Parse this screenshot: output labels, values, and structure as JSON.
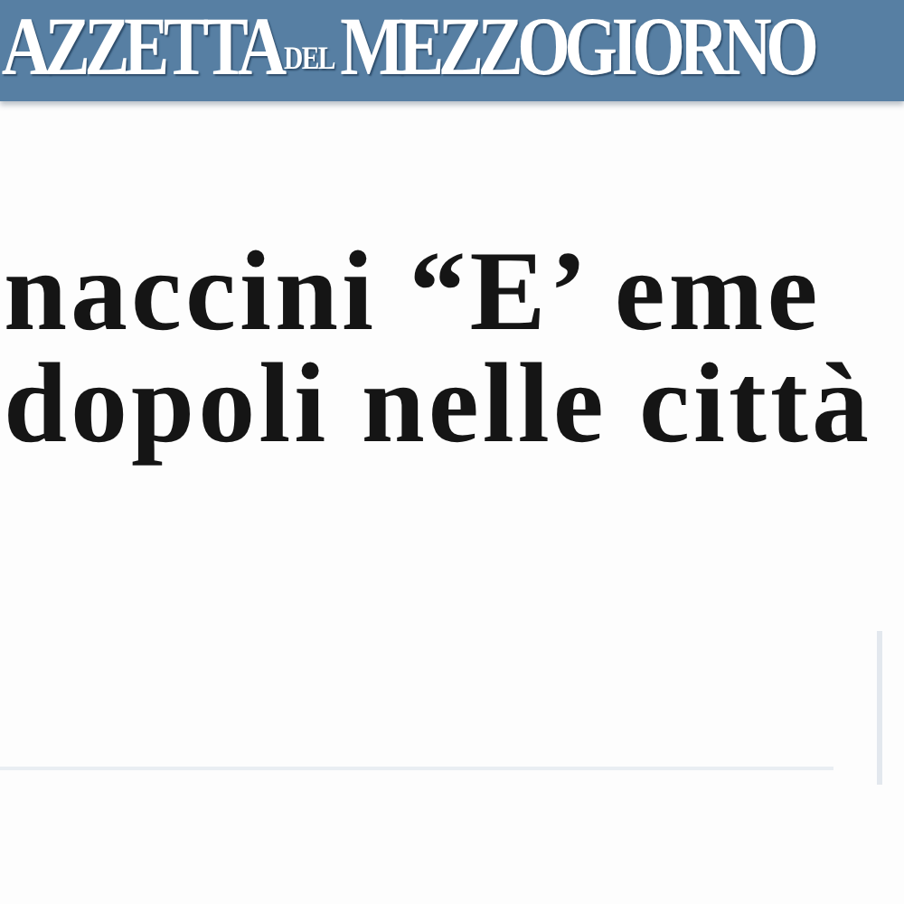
{
  "masthead": {
    "logo_parts": [
      "AZZETTA",
      "DEL",
      "MEZZOGIORNO"
    ]
  },
  "headline": {
    "lines": [
      "naccini “E’ eme",
      "dopoli nelle città"
    ]
  }
}
